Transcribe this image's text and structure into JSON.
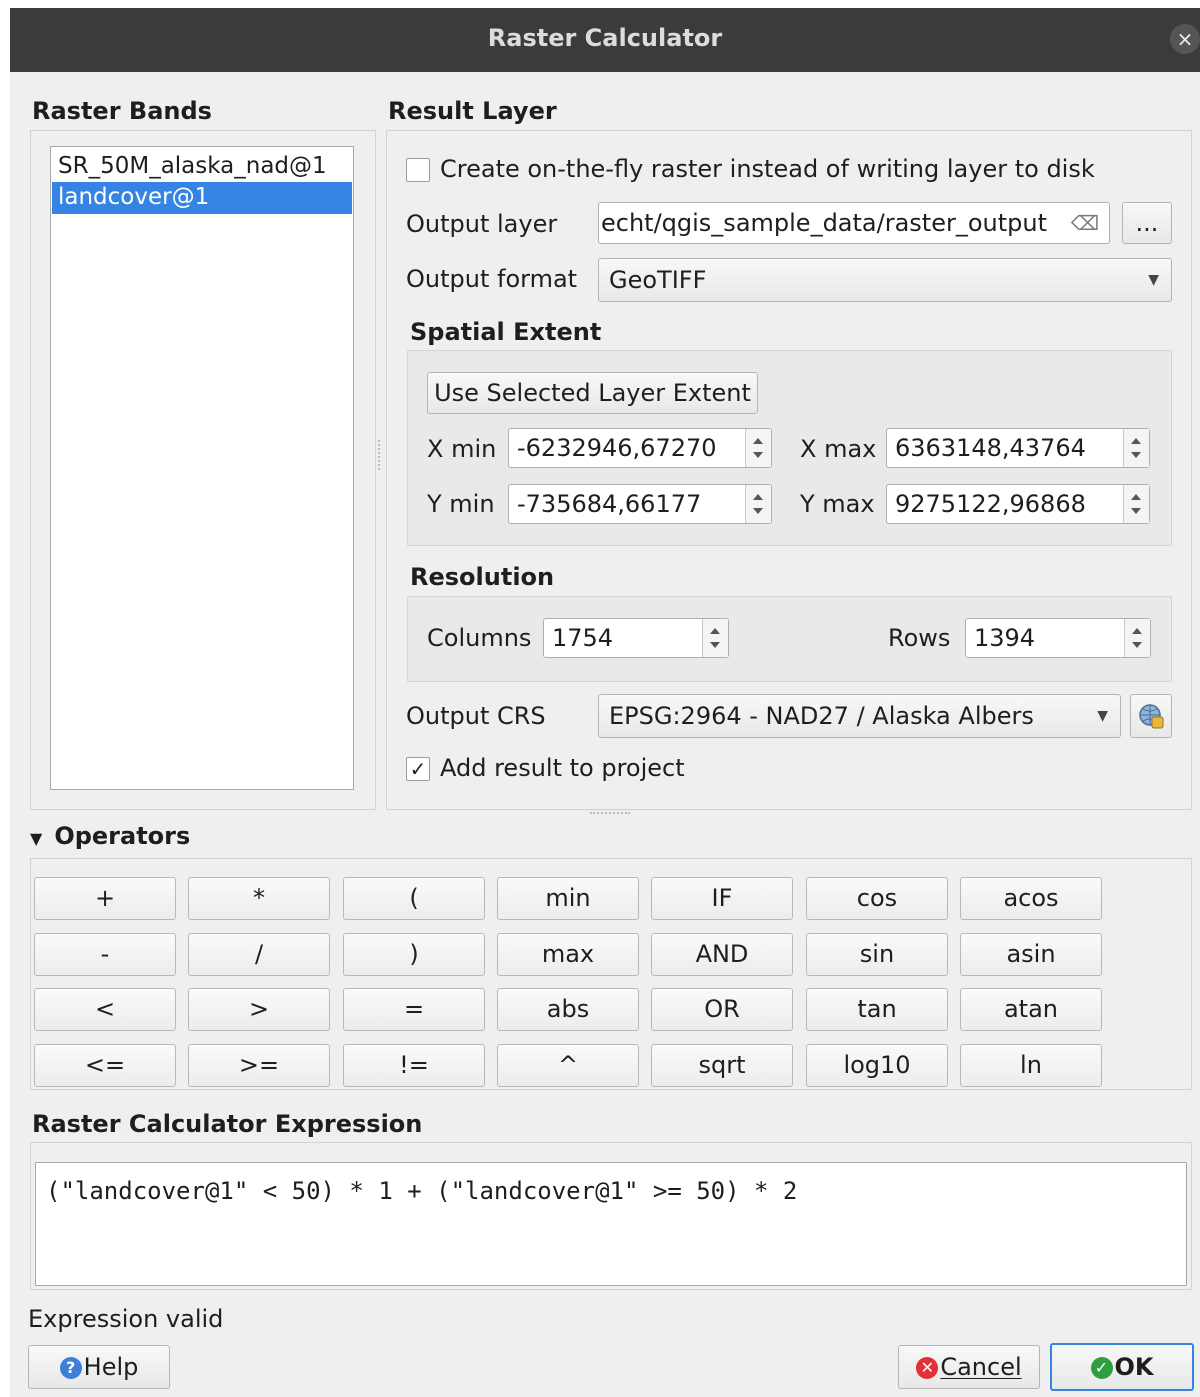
{
  "window": {
    "title": "Raster Calculator",
    "close_glyph": "×"
  },
  "raster_bands": {
    "heading": "Raster Bands",
    "items": [
      {
        "label": "SR_50M_alaska_nad@1",
        "selected": false
      },
      {
        "label": "landcover@1",
        "selected": true
      }
    ]
  },
  "result_layer": {
    "heading": "Result Layer",
    "on_the_fly_label": "Create on-the-fly raster instead of writing layer to disk",
    "on_the_fly_checked": false,
    "output_layer_label": "Output layer",
    "output_layer_value": "echt/qgis_sample_data/raster_output",
    "browse_label": "...",
    "output_format_label": "Output format",
    "output_format_value": "GeoTIFF",
    "spatial_extent": {
      "heading": "Spatial Extent",
      "use_selected_label": "Use Selected Layer Extent",
      "xmin_label": "X min",
      "xmin_value": "-6232946,67270",
      "xmax_label": "X max",
      "xmax_value": "6363148,43764",
      "ymin_label": "Y min",
      "ymin_value": "-735684,66177",
      "ymax_label": "Y max",
      "ymax_value": "9275122,96868"
    },
    "resolution": {
      "heading": "Resolution",
      "columns_label": "Columns",
      "columns_value": "1754",
      "rows_label": "Rows",
      "rows_value": "1394"
    },
    "output_crs_label": "Output CRS",
    "output_crs_value": "EPSG:2964 - NAD27 / Alaska Albers",
    "add_result_label": "Add result to project",
    "add_result_checked": true
  },
  "operators": {
    "heading": "Operators",
    "rows": [
      [
        "+",
        "*",
        "(",
        "min",
        "IF",
        "cos",
        "acos"
      ],
      [
        "-",
        "/",
        ")",
        "max",
        "AND",
        "sin",
        "asin"
      ],
      [
        "<",
        ">",
        "=",
        "abs",
        "OR",
        "tan",
        "atan"
      ],
      [
        "<=",
        ">=",
        "!=",
        "^",
        "sqrt",
        "log10",
        "ln"
      ]
    ]
  },
  "expression": {
    "heading": "Raster Calculator Expression",
    "value": "(\"landcover@1\" < 50) * 1 + (\"landcover@1\" >= 50) * 2",
    "status": "Expression valid"
  },
  "footer": {
    "help_label": "Help",
    "cancel_label": "Cancel",
    "ok_label": "OK"
  },
  "colors": {
    "selection": "#3584e4",
    "titlebar": "#3b3b3b",
    "help_icon": "#3c7fd6",
    "cancel_icon": "#e0303a",
    "ok_icon": "#2e9e3e"
  }
}
